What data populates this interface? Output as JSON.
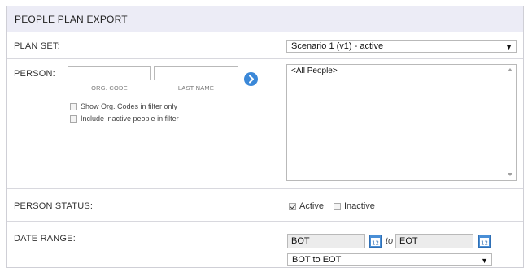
{
  "panel": {
    "title": "PEOPLE PLAN EXPORT"
  },
  "plan_set": {
    "label": "PLAN SET:",
    "selected": "Scenario 1 (v1) - active"
  },
  "person": {
    "label": "PERSON:",
    "org_code_caption": "ORG. CODE",
    "last_name_caption": "LAST NAME",
    "org_code_value": "",
    "last_name_value": "",
    "options": [
      {
        "label": "Show Org. Codes in filter only",
        "checked": false
      },
      {
        "label": "Include inactive people in filter",
        "checked": false
      }
    ],
    "list_items": [
      "<All People>"
    ]
  },
  "person_status": {
    "label": "PERSON STATUS:",
    "active": {
      "label": "Active",
      "checked": true
    },
    "inactive": {
      "label": "Inactive",
      "checked": false
    }
  },
  "date_range": {
    "label": "DATE RANGE:",
    "from": "BOT",
    "to_label": "to",
    "to": "EOT",
    "preset_selected": "BOT to EOT"
  },
  "colors": {
    "accent": "#3b88d8",
    "header_bg": "#ececf6"
  },
  "icons": {
    "go": "arrow-right-circle-icon",
    "calendar": "calendar-icon",
    "dropdown": "dropdown-arrow-icon"
  }
}
